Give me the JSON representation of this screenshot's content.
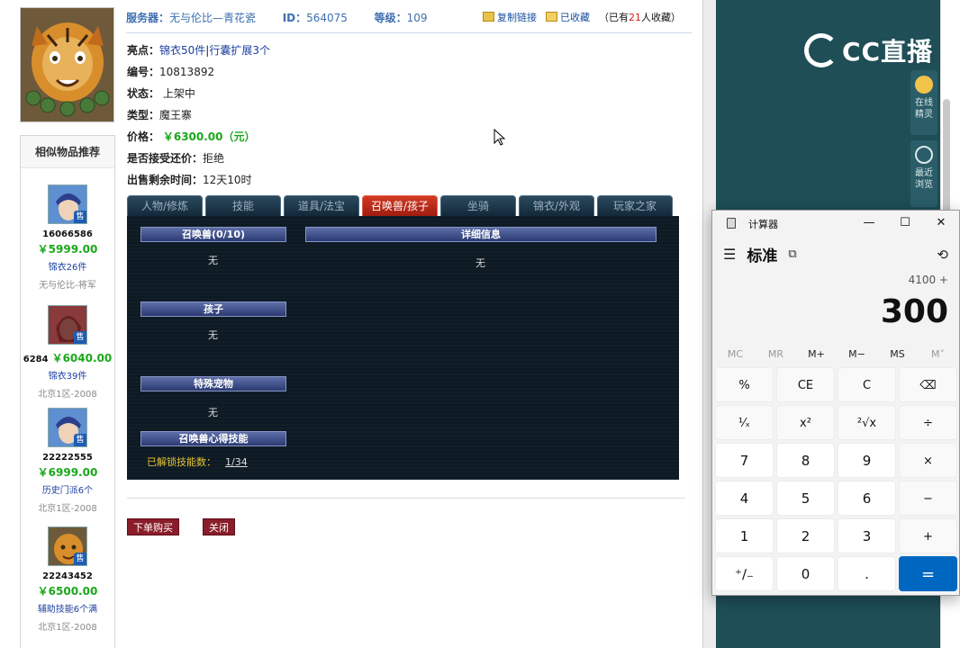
{
  "header": {
    "server_label": "服务器：",
    "server_value": "无与伦比—青花瓷",
    "id_label": "ID：",
    "id_value": "564075",
    "level_label": "等级：",
    "level_value": "109",
    "copy_link": "复制链接",
    "favorited": "已收藏",
    "fav_count_pre": "（已有",
    "fav_count_num": "21",
    "fav_count_post": "人收藏）"
  },
  "info": {
    "highlight_label": "亮点：",
    "highlight_a": "锦衣50件",
    "highlight_sep": "|",
    "highlight_b": "行囊扩展3个",
    "code_label": "编号：",
    "code_value": "10813892",
    "status_label": "状态：",
    "status_value": "上架中",
    "type_label": "类型：",
    "type_value": "魔王寨",
    "price_label": "价格：",
    "price_value": "￥6300.00（元）",
    "counter_label": "是否接受还价：",
    "counter_value": "拒绝",
    "remaining_label": "出售剩余时间：",
    "remaining_value": "12天10时"
  },
  "tabs": [
    {
      "label": "人物/修炼"
    },
    {
      "label": "技能"
    },
    {
      "label": "道具/法宝"
    },
    {
      "label": "召唤兽/孩子",
      "active": true
    },
    {
      "label": "坐骑"
    },
    {
      "label": "锦衣/外观"
    },
    {
      "label": "玩家之家"
    }
  ],
  "panel": {
    "pets_title": "召唤兽(0/10)",
    "pets_value": "无",
    "detail_title": "详细信息",
    "detail_value": "无",
    "child_title": "孩子",
    "child_value": "无",
    "special_title": "特殊宠物",
    "special_value": "无",
    "skill_title": "召唤兽心得技能",
    "unlock_label": "已解锁技能数：",
    "unlock_value": "1/34"
  },
  "actions": {
    "buy": "下单购买",
    "close": "关闭"
  },
  "similar": {
    "title": "相似物品推荐",
    "items": [
      {
        "id": "16066586",
        "price": "￥5999.00",
        "desc": "锦衣26件",
        "server": "无与伦比-将军",
        "sold": "售"
      },
      {
        "id": "6284",
        "price": "￥6040.00",
        "desc": "锦衣39件",
        "server": "北京1区-2008",
        "sold": "售"
      },
      {
        "id": "22222555",
        "price": "￥6999.00",
        "desc": "历史门派6个",
        "server": "北京1区-2008",
        "sold": "售"
      },
      {
        "id": "22243452",
        "price": "￥6500.00",
        "desc": "辅助技能6个满",
        "server": "北京1区-2008",
        "sold": "售"
      }
    ]
  },
  "cc": {
    "logo": "CC直播",
    "online_sprite": "在线精灵",
    "recent_browse": "最近浏览"
  },
  "calculator": {
    "title": "计算器",
    "mode": "标准",
    "expression": "4100 +",
    "display": "300",
    "memory": [
      "MC",
      "MR",
      "M+",
      "M−",
      "MS",
      "M˅"
    ],
    "keys": [
      "%",
      "CE",
      "C",
      "⌫",
      "¹⁄ₓ",
      "x²",
      "²√x",
      "÷",
      "7",
      "8",
      "9",
      "×",
      "4",
      "5",
      "6",
      "−",
      "1",
      "2",
      "3",
      "+",
      "⁺∕₋",
      "0",
      ".",
      "="
    ],
    "min": "—",
    "max": "☐",
    "close": "✕"
  },
  "colors": {
    "price_green": "#1aa81a",
    "tab_active": "#c2301b",
    "cc_bg": "#1f4e57",
    "calc_equals": "#0067c0"
  }
}
